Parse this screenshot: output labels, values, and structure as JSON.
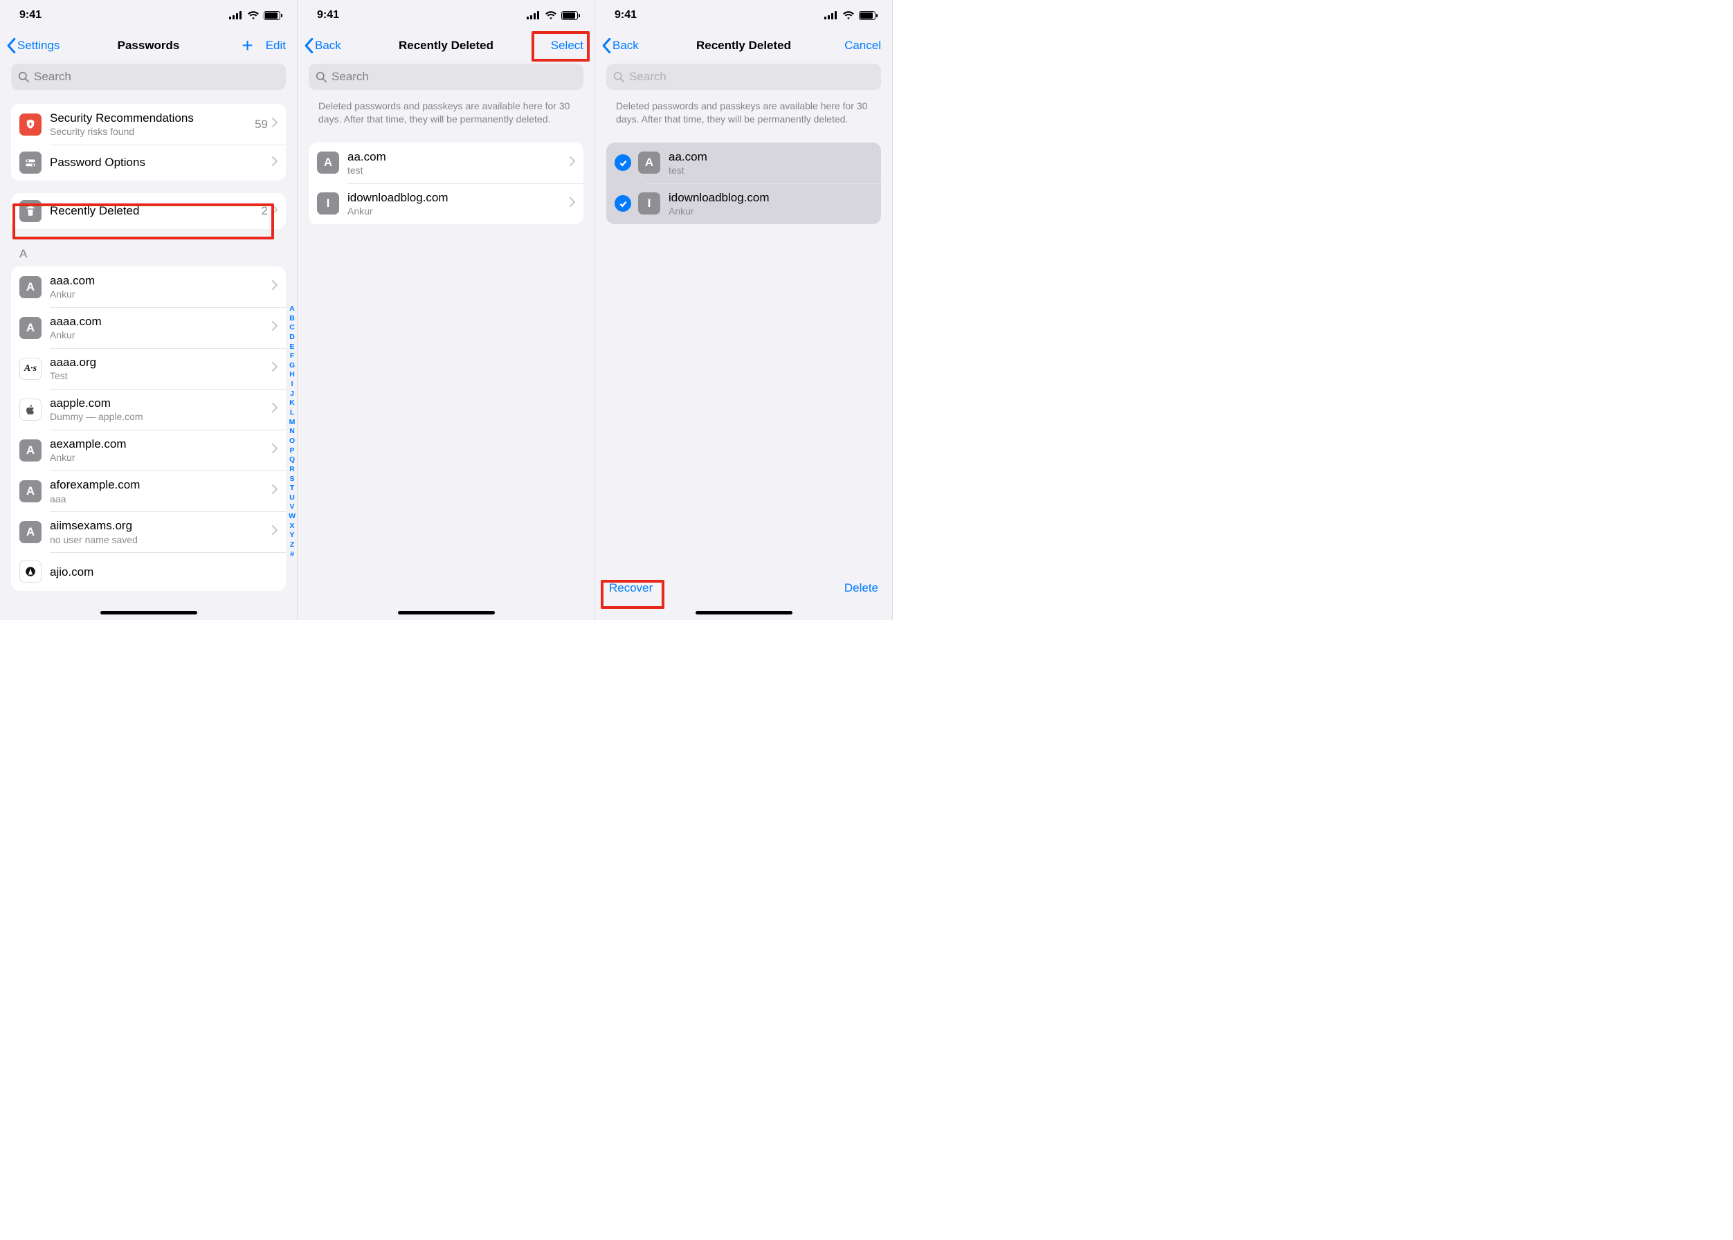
{
  "status": {
    "time": "9:41"
  },
  "screen1": {
    "back": "Settings",
    "title": "Passwords",
    "edit": "Edit",
    "search_placeholder": "Search",
    "rows": {
      "security": {
        "title": "Security Recommendations",
        "subtitle": "Security risks found",
        "count": "59"
      },
      "options": {
        "title": "Password Options"
      },
      "recently_deleted": {
        "title": "Recently Deleted",
        "count": "2"
      }
    },
    "section_a": "A",
    "passwords": [
      {
        "initial": "A",
        "title": "aaa.com",
        "sub": "Ankur"
      },
      {
        "initial": "A",
        "title": "aaaa.com",
        "sub": "Ankur"
      },
      {
        "initial": "A-s",
        "title": "aaaa.org",
        "sub": "Test",
        "style": "as"
      },
      {
        "initial": "apple",
        "title": "aapple.com",
        "sub": "Dummy — apple.com",
        "style": "apple"
      },
      {
        "initial": "A",
        "title": "aexample.com",
        "sub": "Ankur"
      },
      {
        "initial": "A",
        "title": "aforexample.com",
        "sub": "aaa"
      },
      {
        "initial": "A",
        "title": "aiimsexams.org",
        "sub": "no user name saved"
      },
      {
        "initial": "A",
        "title": "ajio.com",
        "sub": "",
        "style": "black-circle"
      }
    ],
    "index": [
      "A",
      "B",
      "C",
      "D",
      "E",
      "F",
      "G",
      "H",
      "I",
      "J",
      "K",
      "L",
      "M",
      "N",
      "O",
      "P",
      "Q",
      "R",
      "S",
      "T",
      "U",
      "V",
      "W",
      "X",
      "Y",
      "Z",
      "#"
    ]
  },
  "screen2": {
    "back": "Back",
    "title": "Recently Deleted",
    "select": "Select",
    "search_placeholder": "Search",
    "info": "Deleted passwords and passkeys are available here for 30 days. After that time, they will be permanently deleted.",
    "items": [
      {
        "initial": "A",
        "title": "aa.com",
        "sub": "test"
      },
      {
        "initial": "I",
        "title": "idownloadblog.com",
        "sub": "Ankur"
      }
    ]
  },
  "screen3": {
    "back": "Back",
    "title": "Recently Deleted",
    "cancel": "Cancel",
    "search_placeholder": "Search",
    "info": "Deleted passwords and passkeys are available here for 30 days. After that time, they will be permanently deleted.",
    "items": [
      {
        "initial": "A",
        "title": "aa.com",
        "sub": "test"
      },
      {
        "initial": "I",
        "title": "idownloadblog.com",
        "sub": "Ankur"
      }
    ],
    "recover": "Recover",
    "delete": "Delete"
  }
}
